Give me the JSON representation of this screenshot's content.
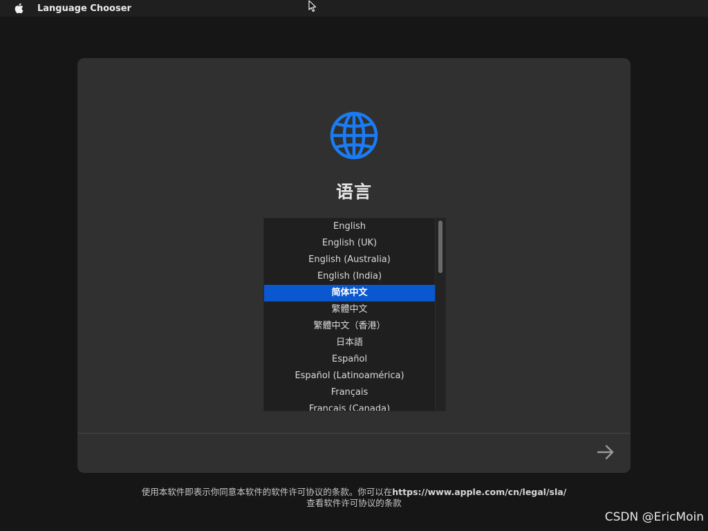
{
  "menubar": {
    "app_name": "Language Chooser"
  },
  "icons": {
    "apple": "apple-logo-icon",
    "globe": "globe-icon",
    "next": "arrow-right-icon",
    "cursor": "mouse-pointer-icon"
  },
  "colors": {
    "accent": "#0a58d0",
    "globe": "#1a7cf5",
    "window_bg": "#303030",
    "desktop_bg": "#161616"
  },
  "window": {
    "title": "语言",
    "languages": [
      {
        "label": "English",
        "selected": false
      },
      {
        "label": "English (UK)",
        "selected": false
      },
      {
        "label": "English (Australia)",
        "selected": false
      },
      {
        "label": "English (India)",
        "selected": false
      },
      {
        "label": "简体中文",
        "selected": true
      },
      {
        "label": "繁體中文",
        "selected": false
      },
      {
        "label": "繁體中文（香港）",
        "selected": false
      },
      {
        "label": "日本語",
        "selected": false
      },
      {
        "label": "Español",
        "selected": false
      },
      {
        "label": "Español (Latinoamérica)",
        "selected": false
      },
      {
        "label": "Français",
        "selected": false
      },
      {
        "label": "Français (Canada)",
        "selected": false
      }
    ]
  },
  "license": {
    "line1_text": "使用本软件即表示你同意本软件的软件许可协议的条款。你可以在",
    "line1_link": "https://www.apple.com/cn/legal/sla/",
    "line2_text": "查看软件许可协议的条款"
  },
  "watermark": "CSDN @EricMoin"
}
